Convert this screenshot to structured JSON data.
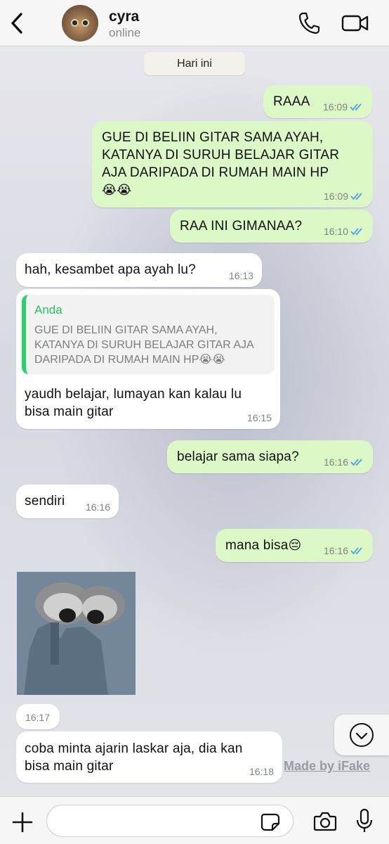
{
  "header": {
    "back_icon": "chevron-left-icon",
    "contact_name": "cyra",
    "status": "online",
    "call_icon": "phone-icon",
    "video_icon": "video-camera-icon"
  },
  "date_separator": "Hari ini",
  "messages": [
    {
      "dir": "out",
      "text": "RAAA",
      "time": "16:09",
      "read": true
    },
    {
      "dir": "out",
      "text_lines": [
        "GUE DI BELIIN GITAR SAMA AYAH,",
        "KATANYA DI SURUH BELAJAR GITAR",
        "AJA DARIPADA DI RUMAH MAIN HP"
      ],
      "emoji": "😭😭",
      "time": "16:09",
      "read": true
    },
    {
      "dir": "out",
      "text": "RAA INI GIMANAA?",
      "time": "16:10",
      "read": true
    },
    {
      "dir": "in",
      "text": "hah, kesambet apa ayah lu?",
      "time": "16:13"
    },
    {
      "dir": "in",
      "quote": {
        "name": "Anda",
        "text_lines": [
          "GUE DI BELIIN GITAR SAMA AYAH,",
          "KATANYA DI SURUH BELAJAR GITAR AJA",
          "DARIPADA DI RUMAH MAIN HP"
        ],
        "emoji": "😭😭"
      },
      "text_lines": [
        "yaudh belajar, lumayan kan kalau lu",
        "bisa main gitar"
      ],
      "time": "16:15"
    },
    {
      "dir": "out",
      "text": "belajar sama siapa?",
      "time": "16:16",
      "read": true
    },
    {
      "dir": "in",
      "text": "sendiri",
      "time": "16:16"
    },
    {
      "dir": "out",
      "text": "mana bisa",
      "emoji": "😔",
      "time": "16:16",
      "read": true
    },
    {
      "dir": "in",
      "type": "sticker",
      "time": "16:17"
    },
    {
      "dir": "in",
      "text_lines": [
        "coba minta ajarin laskar aja, dia kan",
        "bisa main gitar"
      ],
      "time": "16:18"
    }
  ],
  "watermark": "Made by iFake",
  "colors": {
    "outgoing": "#dcf8c6",
    "incoming": "#ffffff",
    "ticks": "#4fa3e0",
    "quote_accent": "#25d366"
  },
  "input_bar": {
    "plus_icon": "plus-icon",
    "message_placeholder": "",
    "sticker_icon": "sticker-icon",
    "camera_icon": "camera-icon",
    "mic_icon": "microphone-icon"
  }
}
